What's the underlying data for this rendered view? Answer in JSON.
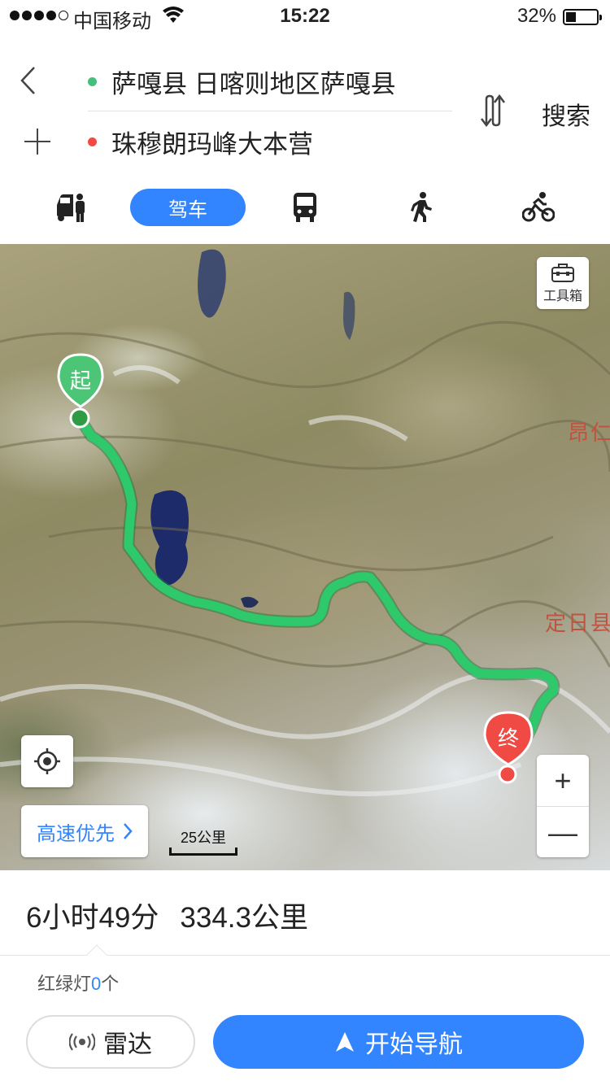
{
  "status_bar": {
    "carrier": "中国移动",
    "time": "15:22",
    "battery": "32%"
  },
  "route": {
    "origin": "萨嘎县 日喀则地区萨嘎县",
    "destination": "珠穆朗玛峰大本营",
    "search_label": "搜索"
  },
  "modes": {
    "active_label": "驾车"
  },
  "map": {
    "toolbox_label": "工具箱",
    "start_marker": "起",
    "end_marker": "终",
    "place_label_1": "昂仁",
    "place_label_2": "定日县",
    "route_preference": "高速优先",
    "scale_label": "25公里",
    "zoom_in": "+",
    "zoom_out": "—"
  },
  "summary": {
    "duration": "6小时49分",
    "distance": "334.3公里",
    "traffic_lights_label": "红绿灯",
    "traffic_lights_count": "0",
    "traffic_lights_unit": "个"
  },
  "actions": {
    "radar_label": "雷达",
    "navigate_label": "开始导航"
  },
  "colors": {
    "accent": "#3385ff",
    "route": "#2ec96a",
    "start": "#44c07c",
    "end": "#f04a44"
  }
}
